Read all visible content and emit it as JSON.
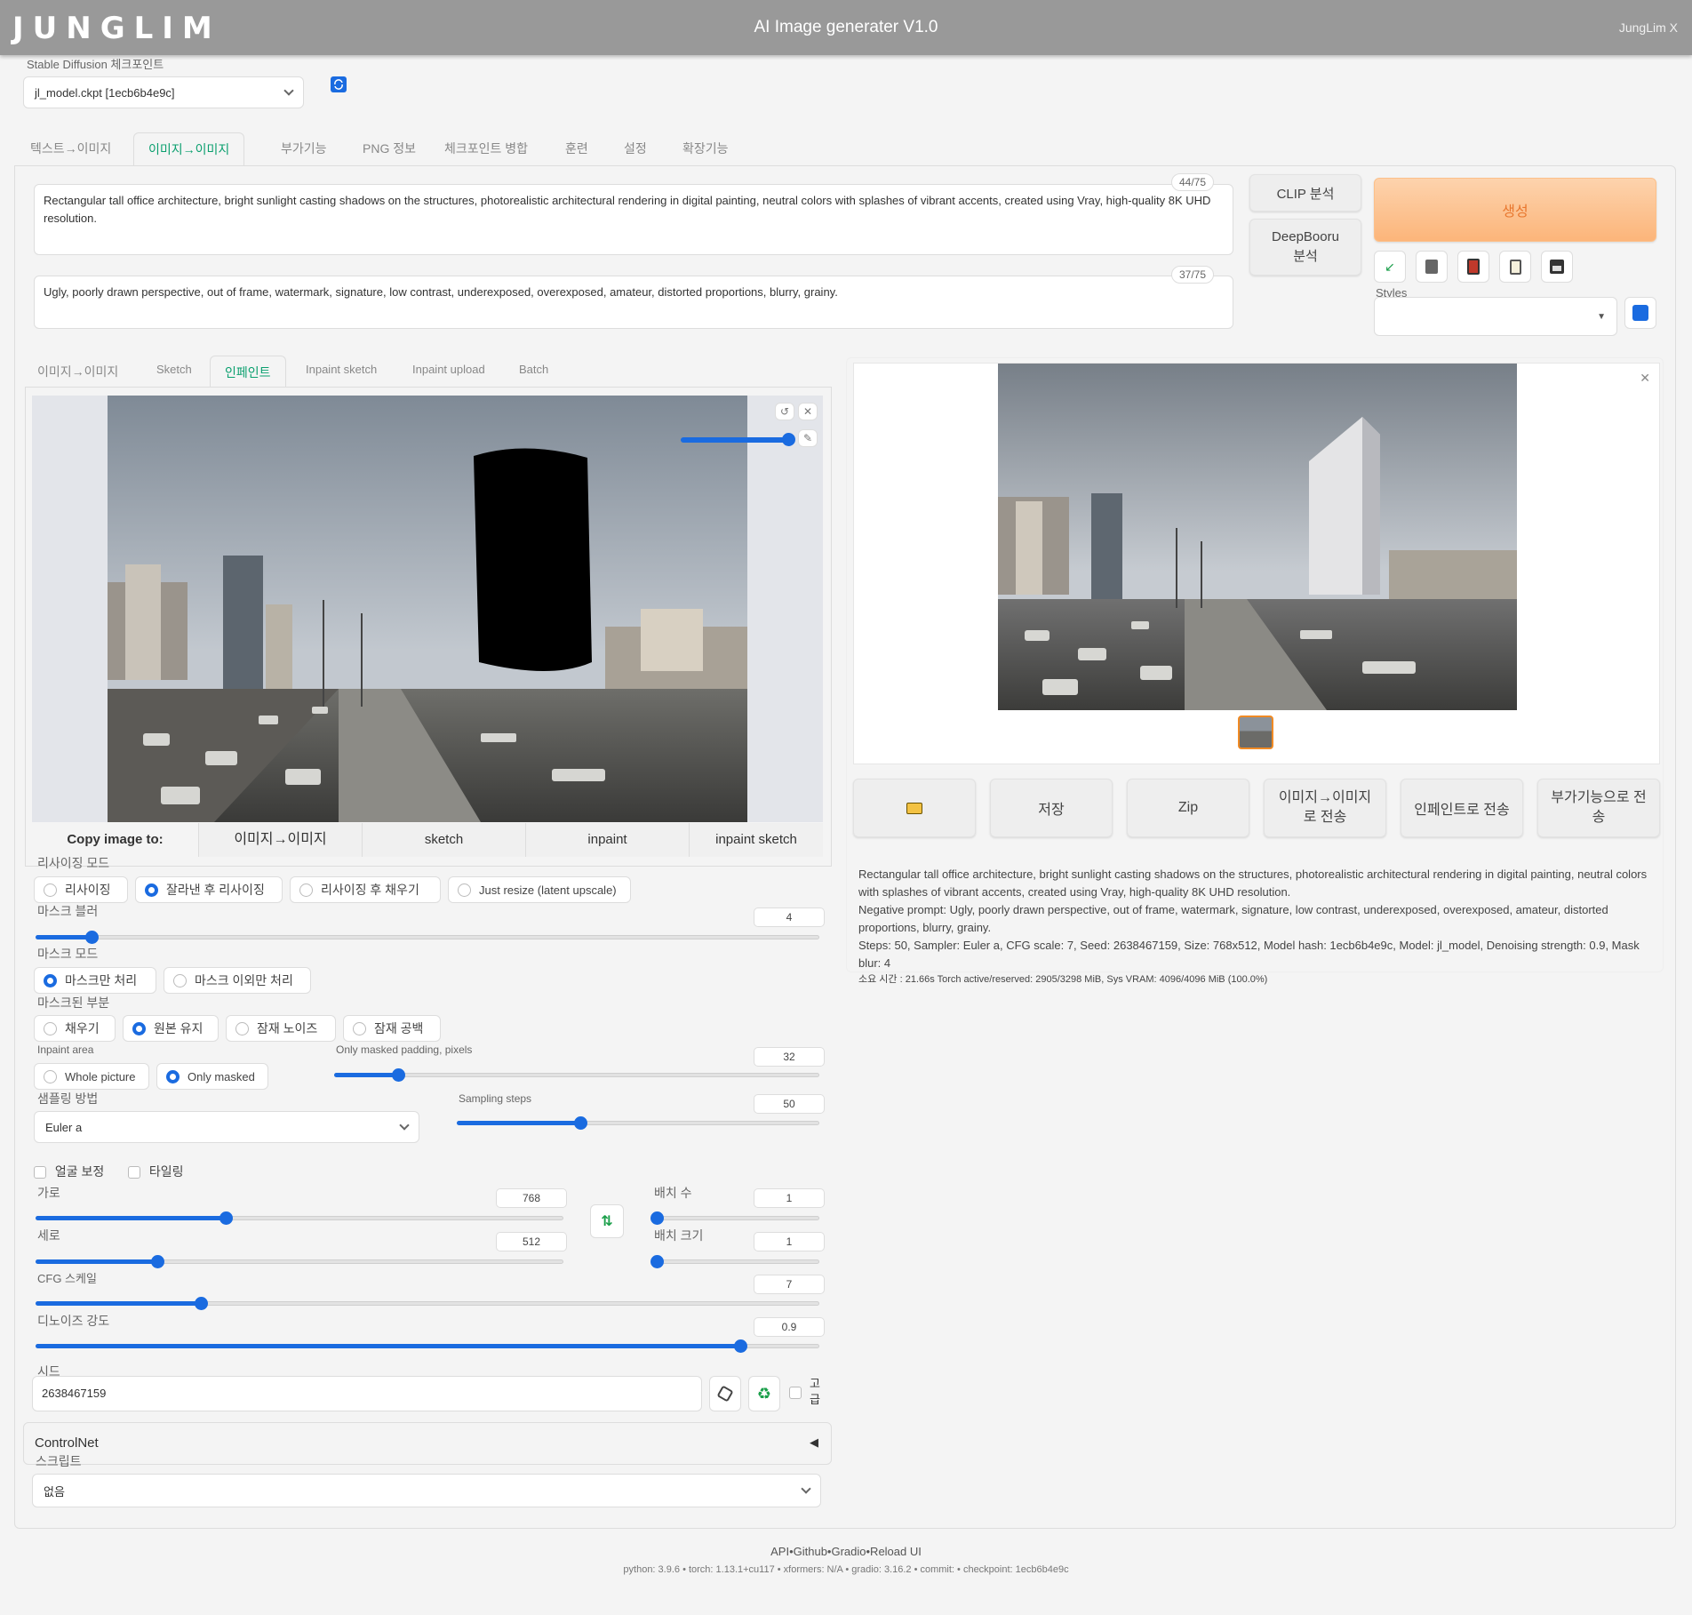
{
  "header": {
    "logo": "JUNGLIM",
    "title": "AI Image generater V1.0",
    "user": "JungLim X"
  },
  "checkpoint": {
    "label": "Stable Diffusion 체크포인트",
    "value": "jl_model.ckpt [1ecb6b4e9c]"
  },
  "main_tabs": [
    "텍스트→이미지",
    "이미지→이미지",
    "부가기능",
    "PNG 정보",
    "체크포인트 병합",
    "훈련",
    "설정",
    "확장기능"
  ],
  "prompt": {
    "positive": "Rectangular tall office architecture, bright sunlight casting shadows on the structures, photorealistic architectural rendering in digital painting, neutral colors with splashes of vibrant accents, created using Vray, high-quality 8K UHD resolution.",
    "positive_count": "44/75",
    "negative": "Ugly, poorly drawn perspective, out of frame, watermark, signature, low contrast, underexposed, overexposed, amateur, distorted proportions, blurry, grainy.",
    "negative_count": "37/75"
  },
  "actions": {
    "clip": "CLIP 분석",
    "deepbooru": "DeepBooru 분석",
    "generate": "생성",
    "styles_label": "Styles"
  },
  "sub_tabs": [
    "이미지→이미지",
    "Sketch",
    "인페인트",
    "Inpaint sketch",
    "Inpaint upload",
    "Batch"
  ],
  "copy_to": {
    "label": "Copy image to:",
    "items": [
      "이미지→이미지",
      "sketch",
      "inpaint",
      "inpaint sketch"
    ]
  },
  "resize_mode": {
    "label": "리사이징 모드",
    "options": [
      "리사이징",
      "잘라낸 후 리사이징",
      "리사이징 후 채우기",
      "Just resize (latent upscale)"
    ],
    "selected": 1
  },
  "mask_blur": {
    "label": "마스크 블러",
    "value": "4",
    "fraction": 0.07
  },
  "mask_mode": {
    "label": "마스크 모드",
    "options": [
      "마스크만 처리",
      "마스크 이외만 처리"
    ],
    "selected": 0
  },
  "masked_content": {
    "label": "마스크된 부분",
    "options": [
      "채우기",
      "원본 유지",
      "잠재 노이즈",
      "잠재 공백"
    ],
    "selected": 1
  },
  "inpaint_area": {
    "label": "Inpaint area",
    "options": [
      "Whole picture",
      "Only masked"
    ],
    "selected": 1
  },
  "padding": {
    "label": "Only masked padding, pixels",
    "value": "32",
    "fraction": 0.13
  },
  "sampler": {
    "label": "샘플링 방법",
    "value": "Euler a"
  },
  "steps": {
    "label": "Sampling steps",
    "value": "50",
    "fraction": 0.34
  },
  "checks": {
    "face": "얼굴 보정",
    "tiling": "타일링"
  },
  "width": {
    "label": "가로",
    "value": "768",
    "fraction": 0.36
  },
  "height": {
    "label": "세로",
    "value": "512",
    "fraction": 0.23
  },
  "batch_count": {
    "label": "배치 수",
    "value": "1",
    "fraction": 0.0
  },
  "batch_size": {
    "label": "배치 크기",
    "value": "1",
    "fraction": 0.0
  },
  "cfg": {
    "label": "CFG 스케일",
    "value": "7",
    "fraction": 0.21
  },
  "denoise": {
    "label": "디노이즈 강도",
    "value": "0.9",
    "fraction": 0.9
  },
  "seed": {
    "label": "시드",
    "value": "2638467159",
    "extra": "고급"
  },
  "controlnet": {
    "label": "ControlNet"
  },
  "script": {
    "label": "스크립트",
    "value": "없음"
  },
  "output_buttons": [
    "저장",
    "Zip",
    "이미지→이미지로 전송",
    "인페인트로 전송",
    "부가기능으로 전송"
  ],
  "output_info": {
    "prompt": "Rectangular tall office architecture, bright sunlight casting shadows on the structures, photorealistic architectural rendering in digital painting, neutral colors with splashes of vibrant accents, created using Vray, high-quality 8K UHD resolution.",
    "negative": "Negative prompt: Ugly, poorly drawn perspective, out of frame, watermark, signature, low contrast, underexposed, overexposed, amateur, distorted proportions, blurry, grainy.",
    "params": "Steps: 50, Sampler: Euler a, CFG scale: 7, Seed: 2638467159, Size: 768x512, Model hash: 1ecb6b4e9c, Model: jl_model, Denoising strength: 0.9, Mask blur: 4",
    "time": "소요 시간 : 21.66s  Torch active/reserved: 2905/3298 MiB, Sys VRAM: 4096/4096 MiB (100.0%)"
  },
  "footer": {
    "links": "API•Github•Gradio•Reload UI",
    "versions": "python: 3.9.6  •  torch: 1.13.1+cu117  •  xformers: N/A  •  gradio: 3.16.2  •  commit:   •  checkpoint: 1ecb6b4e9c"
  },
  "colors": {
    "accent": "#1a6be0",
    "active_tab": "#0a9f6e",
    "generate": "#fcc08a",
    "header": "#999999"
  }
}
